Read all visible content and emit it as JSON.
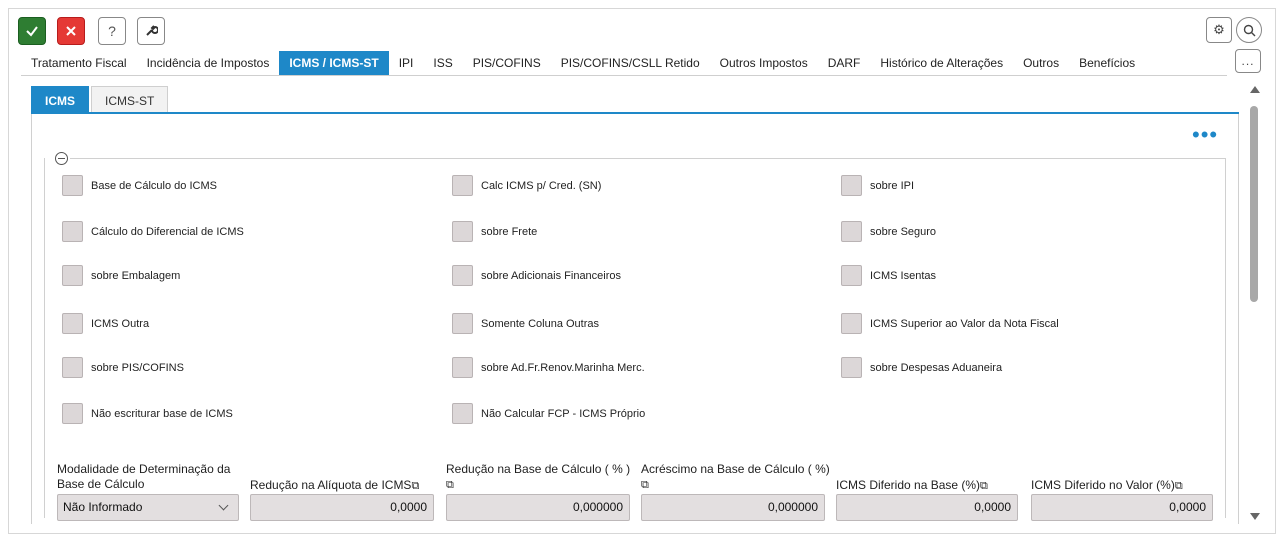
{
  "toolbar": {
    "confirm_icon": "check-icon",
    "cancel_icon": "close-icon",
    "help_icon": "question-icon",
    "tool_icon": "wrench-icon"
  },
  "main_tabs": [
    {
      "label": "Tratamento Fiscal",
      "active": false
    },
    {
      "label": "Incidência de Impostos",
      "active": false
    },
    {
      "label": "ICMS / ICMS-ST",
      "active": true
    },
    {
      "label": "IPI",
      "active": false
    },
    {
      "label": "ISS",
      "active": false
    },
    {
      "label": "PIS/COFINS",
      "active": false
    },
    {
      "label": "PIS/COFINS/CSLL Retido",
      "active": false
    },
    {
      "label": "Outros Impostos",
      "active": false
    },
    {
      "label": "DARF",
      "active": false
    },
    {
      "label": "Histórico de Alterações",
      "active": false
    },
    {
      "label": "Outros",
      "active": false
    },
    {
      "label": "Benefícios",
      "active": false
    }
  ],
  "sub_tabs": [
    {
      "label": "ICMS",
      "active": true
    },
    {
      "label": "ICMS-ST",
      "active": false
    }
  ],
  "checkboxes": {
    "col1": [
      "Base de Cálculo do ICMS",
      "Cálculo do Diferencial de ICMS",
      "sobre Embalagem",
      "ICMS Outra",
      "sobre PIS/COFINS",
      "Não escriturar base de ICMS"
    ],
    "col2": [
      "Calc ICMS p/ Cred. (SN)",
      "sobre Frete",
      "sobre Adicionais Financeiros",
      "Somente Coluna Outras",
      "sobre Ad.Fr.Renov.Marinha Merc.",
      "Não Calcular FCP - ICMS Próprio"
    ],
    "col3": [
      "sobre IPI",
      "sobre Seguro",
      "ICMS Isentas",
      "ICMS Superior ao Valor da Nota Fiscal",
      "sobre Despesas Aduaneira"
    ]
  },
  "fields": {
    "modalidade": {
      "label": "Modalidade de Determinação da Base de Cálculo",
      "value": "Não Informado"
    },
    "reducao_aliquota": {
      "label": "Redução na Alíquota de ICMS",
      "value": "0,0000"
    },
    "reducao_base": {
      "label": "Redução na Base de Cálculo ( % )",
      "value": "0,000000"
    },
    "acrescimo_base": {
      "label": "Acréscimo na Base de Cálculo ( %)",
      "value": "0,000000"
    },
    "diferido_base": {
      "label": "ICMS Diferido na Base (%)",
      "value": "0,0000"
    },
    "diferido_valor": {
      "label": "ICMS Diferido no Valor (%)",
      "value": "0,0000"
    }
  },
  "more_label": "...",
  "colors": {
    "accent": "#1e88c8",
    "confirm": "#2e7d32",
    "cancel": "#e53935"
  }
}
